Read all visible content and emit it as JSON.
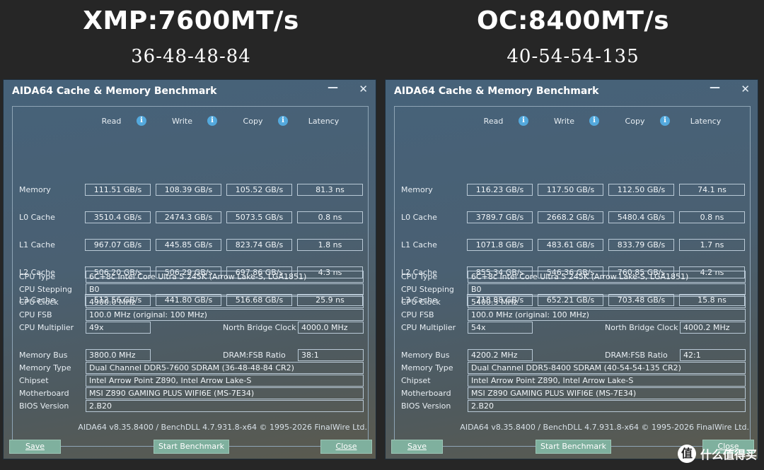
{
  "headings": [
    {
      "title": "XMP:7600MT/s",
      "sub": "36-48-48-84"
    },
    {
      "title": "OC:8400MT/s",
      "sub": "40-54-54-135"
    }
  ],
  "column_headers": {
    "read": "Read",
    "write": "Write",
    "copy": "Copy",
    "latency": "Latency"
  },
  "row_labels": {
    "memory": "Memory",
    "l0": "L0 Cache",
    "l1": "L1 Cache",
    "l2": "L2 Cache",
    "l3": "L3 Cache",
    "cpu_type": "CPU Type",
    "cpu_stepping": "CPU Stepping",
    "cpu_clock": "CPU Clock",
    "cpu_fsb": "CPU FSB",
    "cpu_multiplier": "CPU Multiplier",
    "north_bridge_clock": "North Bridge Clock",
    "memory_bus": "Memory Bus",
    "dram_fsb_ratio": "DRAM:FSB Ratio",
    "memory_type": "Memory Type",
    "chipset": "Chipset",
    "motherboard": "Motherboard",
    "bios_version": "BIOS Version"
  },
  "windows": [
    {
      "title": "AIDA64 Cache & Memory Benchmark",
      "minimize_symbol": "—",
      "close_symbol": "✕",
      "bench": {
        "memory": {
          "read": "111.51 GB/s",
          "write": "108.39 GB/s",
          "copy": "105.52 GB/s",
          "latency": "81.3 ns"
        },
        "l0": {
          "read": "3510.4 GB/s",
          "write": "2474.3 GB/s",
          "copy": "5073.5 GB/s",
          "latency": "0.8 ns"
        },
        "l1": {
          "read": "967.07 GB/s",
          "write": "445.85 GB/s",
          "copy": "823.74 GB/s",
          "latency": "1.8 ns"
        },
        "l2": {
          "read": "506.20 GB/s",
          "write": "506.29 GB/s",
          "copy": "697.86 GB/s",
          "latency": "4.3 ns"
        },
        "l3": {
          "read": "512.56 GB/s",
          "write": "441.80 GB/s",
          "copy": "516.68 GB/s",
          "latency": "25.9 ns"
        }
      },
      "info": {
        "cpu_type": "6C+8c Intel Core Ultra 5 245K  (Arrow Lake-S, LGA1851)",
        "cpu_stepping": "B0",
        "cpu_clock": "4900.0 MHz",
        "cpu_fsb": "100.0 MHz  (original: 100 MHz)",
        "cpu_multiplier": "49x",
        "north_bridge_clock": "4000.0 MHz",
        "memory_bus": "3800.0 MHz",
        "dram_fsb_ratio": "38:1",
        "memory_type": "Dual Channel DDR5-7600 SDRAM  (36-48-48-84 CR2)",
        "chipset": "Intel Arrow Point Z890, Intel Arrow Lake-S",
        "motherboard": "MSI Z890 GAMING PLUS WIFI6E (MS-7E34)",
        "bios_version": "2.B20"
      },
      "footer": "AIDA64 v8.35.8400 / BenchDLL 4.7.931.8-x64  © 1995-2026 FinalWire Ltd.",
      "buttons": {
        "save": "Save",
        "start": "Start Benchmark",
        "close": "Close"
      }
    },
    {
      "title": "AIDA64 Cache & Memory Benchmark",
      "minimize_symbol": "—",
      "close_symbol": "✕",
      "bench": {
        "memory": {
          "read": "116.23 GB/s",
          "write": "117.50 GB/s",
          "copy": "112.50 GB/s",
          "latency": "74.1 ns"
        },
        "l0": {
          "read": "3789.7 GB/s",
          "write": "2668.2 GB/s",
          "copy": "5480.4 GB/s",
          "latency": "0.8 ns"
        },
        "l1": {
          "read": "1071.8 GB/s",
          "write": "483.61 GB/s",
          "copy": "833.79 GB/s",
          "latency": "1.7 ns"
        },
        "l2": {
          "read": "855.34 GB/s",
          "write": "546.36 GB/s",
          "copy": "760.85 GB/s",
          "latency": "4.2 ns"
        },
        "l3": {
          "read": "718.88 GB/s",
          "write": "652.21 GB/s",
          "copy": "703.48 GB/s",
          "latency": "15.8 ns"
        }
      },
      "info": {
        "cpu_type": "6C+8c Intel Core Ultra 5 245K  (Arrow Lake-S, LGA1851)",
        "cpu_stepping": "B0",
        "cpu_clock": "5400.3 MHz",
        "cpu_fsb": "100.0 MHz  (original: 100 MHz)",
        "cpu_multiplier": "54x",
        "north_bridge_clock": "4000.2 MHz",
        "memory_bus": "4200.2 MHz",
        "dram_fsb_ratio": "42:1",
        "memory_type": "Dual Channel DDR5-8400 SDRAM  (40-54-54-135 CR2)",
        "chipset": "Intel Arrow Point Z890, Intel Arrow Lake-S",
        "motherboard": "MSI Z890 GAMING PLUS WIFI6E (MS-7E34)",
        "bios_version": "2.B20"
      },
      "footer": "AIDA64 v8.35.8400 / BenchDLL 4.7.931.8-x64  © 1995-2026 FinalWire Ltd.",
      "buttons": {
        "save": "Save",
        "start": "Start Benchmark",
        "close": "Close"
      }
    }
  ],
  "watermark": {
    "logo": "值",
    "text": "什么值得买"
  }
}
